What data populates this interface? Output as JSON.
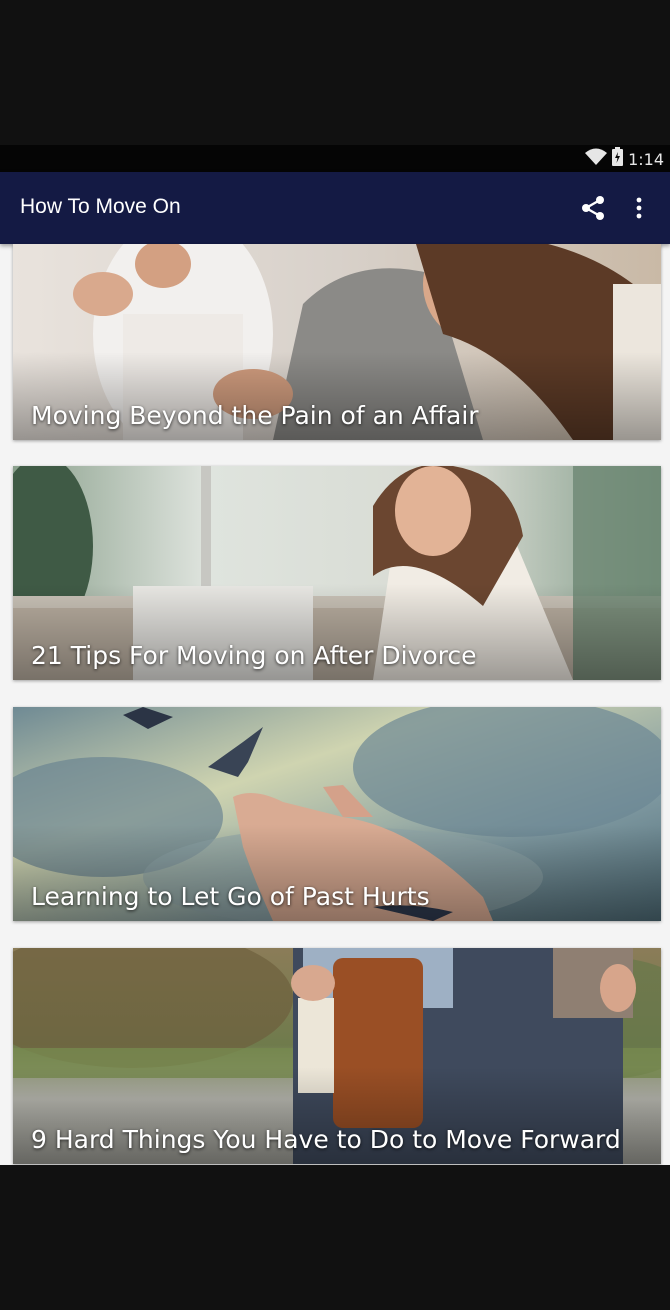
{
  "status_bar": {
    "time": "1:14",
    "icons": [
      "wifi-icon",
      "battery-icon"
    ]
  },
  "app_bar": {
    "title": "How To Move On",
    "actions": [
      "share-icon",
      "more-vert-icon"
    ]
  },
  "articles": [
    {
      "title": "Moving Beyond the Pain of an Affair"
    },
    {
      "title": "21 Tips For Moving on After Divorce"
    },
    {
      "title": "Learning to Let Go of Past Hurts"
    },
    {
      "title": "9 Hard Things You Have to Do to Move Forward"
    }
  ],
  "colors": {
    "app_bar": "#141a44",
    "status_bar": "#050505",
    "background": "#f4f4f4"
  }
}
